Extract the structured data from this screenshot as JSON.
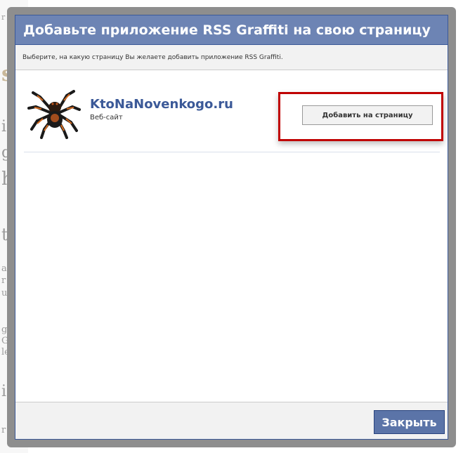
{
  "dialog": {
    "title": "Добавьте приложение RSS Graffiti на свою страницу",
    "instruction": "Выберите, на какую страницу Вы желаете добавить приложение RSS Graffiti.",
    "page": {
      "name": "KtoNaNovenkogo.ru",
      "type": "Веб-сайт",
      "avatar_icon": "spider-avatar-icon"
    },
    "add_button_label": "Добавить на страницу",
    "close_button_label": "Закрыть"
  },
  "colors": {
    "title_bar": "#6d84b4",
    "link": "#3b5998",
    "highlight": "#c00000",
    "close_button": "#5b74a8"
  }
}
